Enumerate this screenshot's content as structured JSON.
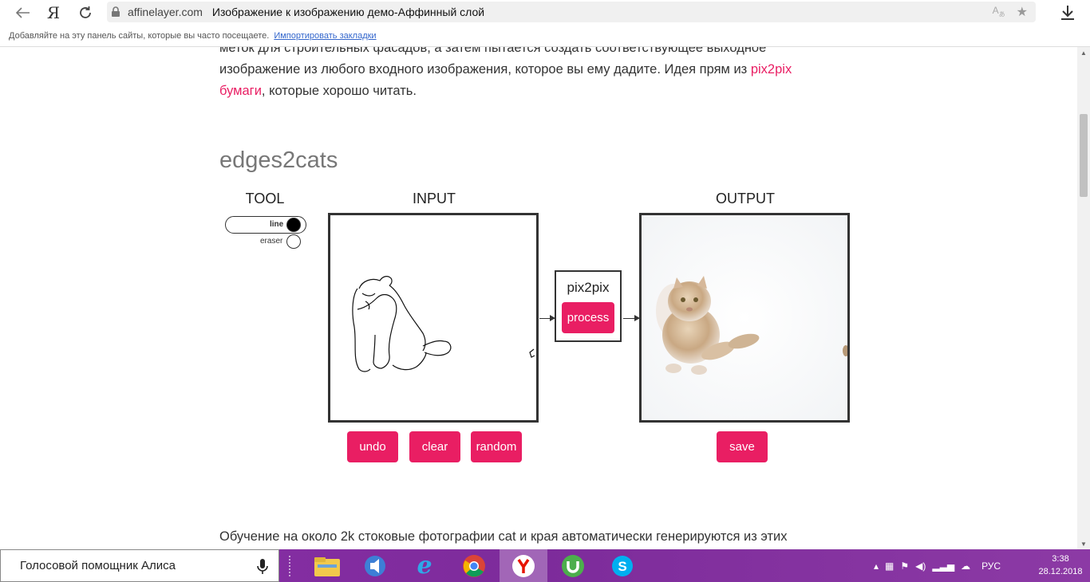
{
  "browser": {
    "logo": "Я",
    "domain": "affinelayer.com",
    "page_title": "Изображение к изображению демо-Аффинный слой",
    "translate_icon": "translate-icon",
    "star_icon": "star-icon",
    "download_icon": "download-icon"
  },
  "bookmarks": {
    "hint": "Добавляйте на эту панель сайты, которые вы часто посещаете.",
    "import_link": "Импортировать закладки"
  },
  "article": {
    "para_line1": "меток для строительных фасадов, а затем пытается создать соответствующее выходное",
    "para_line2": "изображение из любого входного изображения, которое вы ему дадите. Идея прям из ",
    "para_link1": "pix2pix",
    "para_link2": "бумаги",
    "para_line3_rest": ", которые хорошо читать.",
    "section_title": "edges2cats",
    "bottom_text": "Обучение на около 2k стоковые фотографии cat и края автоматически генерируются из этих"
  },
  "demo": {
    "tool_label": "TOOL",
    "input_label": "INPUT",
    "output_label": "OUTPUT",
    "tool_line": "line",
    "tool_eraser": "eraser",
    "selected_tool": "line",
    "pix_label": "pix2pix",
    "process_button": "process",
    "undo_button": "undo",
    "clear_button": "clear",
    "random_button": "random",
    "save_button": "save",
    "accent_color": "#e91e63"
  },
  "taskbar": {
    "assistant_text": "Голосовой помощник Алиса",
    "apps": [
      "file-explorer-icon",
      "media-player-icon",
      "internet-explorer-icon",
      "chrome-icon",
      "yandex-browser-icon",
      "utorrent-icon",
      "skype-icon"
    ],
    "language": "РУС",
    "time": "3:38",
    "date": "28.12.2018"
  }
}
